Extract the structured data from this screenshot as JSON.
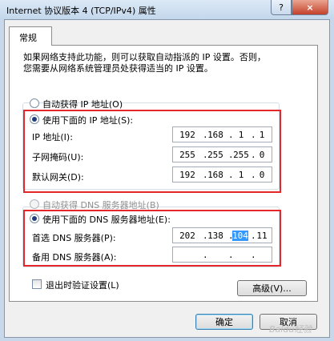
{
  "window": {
    "title": "Internet 协议版本 4 (TCP/IPv4) 属性",
    "help_label": "?",
    "close_label": "×"
  },
  "tab": {
    "label": "常规"
  },
  "description": [
    "如果网络支持此功能，则可以获取自动指派的 IP 设置。否则，",
    "您需要从网络系统管理员处获得适当的 IP 设置。"
  ],
  "ip_section": {
    "auto_label": "自动获得 IP 地址(O)",
    "manual_label": "使用下面的 IP 地址(S):",
    "fields": [
      {
        "label": "IP 地址(I):",
        "value": [
          "192",
          "168",
          "1",
          "1"
        ]
      },
      {
        "label": "子网掩码(U):",
        "value": [
          "255",
          "255",
          "255",
          "0"
        ]
      },
      {
        "label": "默认网关(D):",
        "value": [
          "192",
          "168",
          "1",
          "0"
        ]
      }
    ]
  },
  "dns_section": {
    "auto_label": "自动获得 DNS 服务器地址(B)",
    "manual_label": "使用下面的 DNS 服务器地址(E):",
    "fields": [
      {
        "label": "首选 DNS 服务器(P):",
        "value": [
          "202",
          "138",
          "104",
          "11"
        ]
      },
      {
        "label": "备用 DNS 服务器(A):",
        "value": [
          "",
          "",
          "",
          ""
        ]
      }
    ]
  },
  "validate_label": "退出时验证设置(L)",
  "advanced_label": "高级(V)...",
  "ok_label": "确定",
  "cancel_label": "取消",
  "watermark": "Baidu经验",
  "colors": {
    "highlight_box": "#e5262a",
    "selection": "#3399ff"
  }
}
